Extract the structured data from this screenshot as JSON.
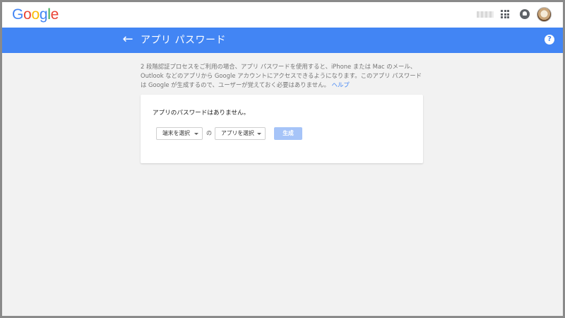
{
  "header": {
    "logo_letters": [
      "G",
      "o",
      "o",
      "g",
      "l",
      "e"
    ],
    "icons": [
      "apps-grid-icon",
      "notifications-icon",
      "account-avatar"
    ]
  },
  "titlebar": {
    "title": "アプリ パスワード",
    "back_icon": "←",
    "help_icon": "?"
  },
  "description": {
    "text": "2 段階認証プロセスをご利用の場合、アプリ パスワードを使用すると、iPhone または Mac のメール、Outlook などのアプリから Google アカウントにアクセスできるようになります。このアプリ パスワードは Google が生成するので、ユーザーが覚えておく必要はありません。",
    "help_link": "ヘルプ"
  },
  "card": {
    "empty_message": "アプリのパスワードはありません。",
    "device_select": "端末を選択",
    "of_label": "の",
    "app_select": "アプリを選択",
    "generate_button": "生成"
  },
  "colors": {
    "accent_blue": "#4285f4",
    "disabled_button": "#a6c4f8",
    "background": "#f2f2f2"
  }
}
